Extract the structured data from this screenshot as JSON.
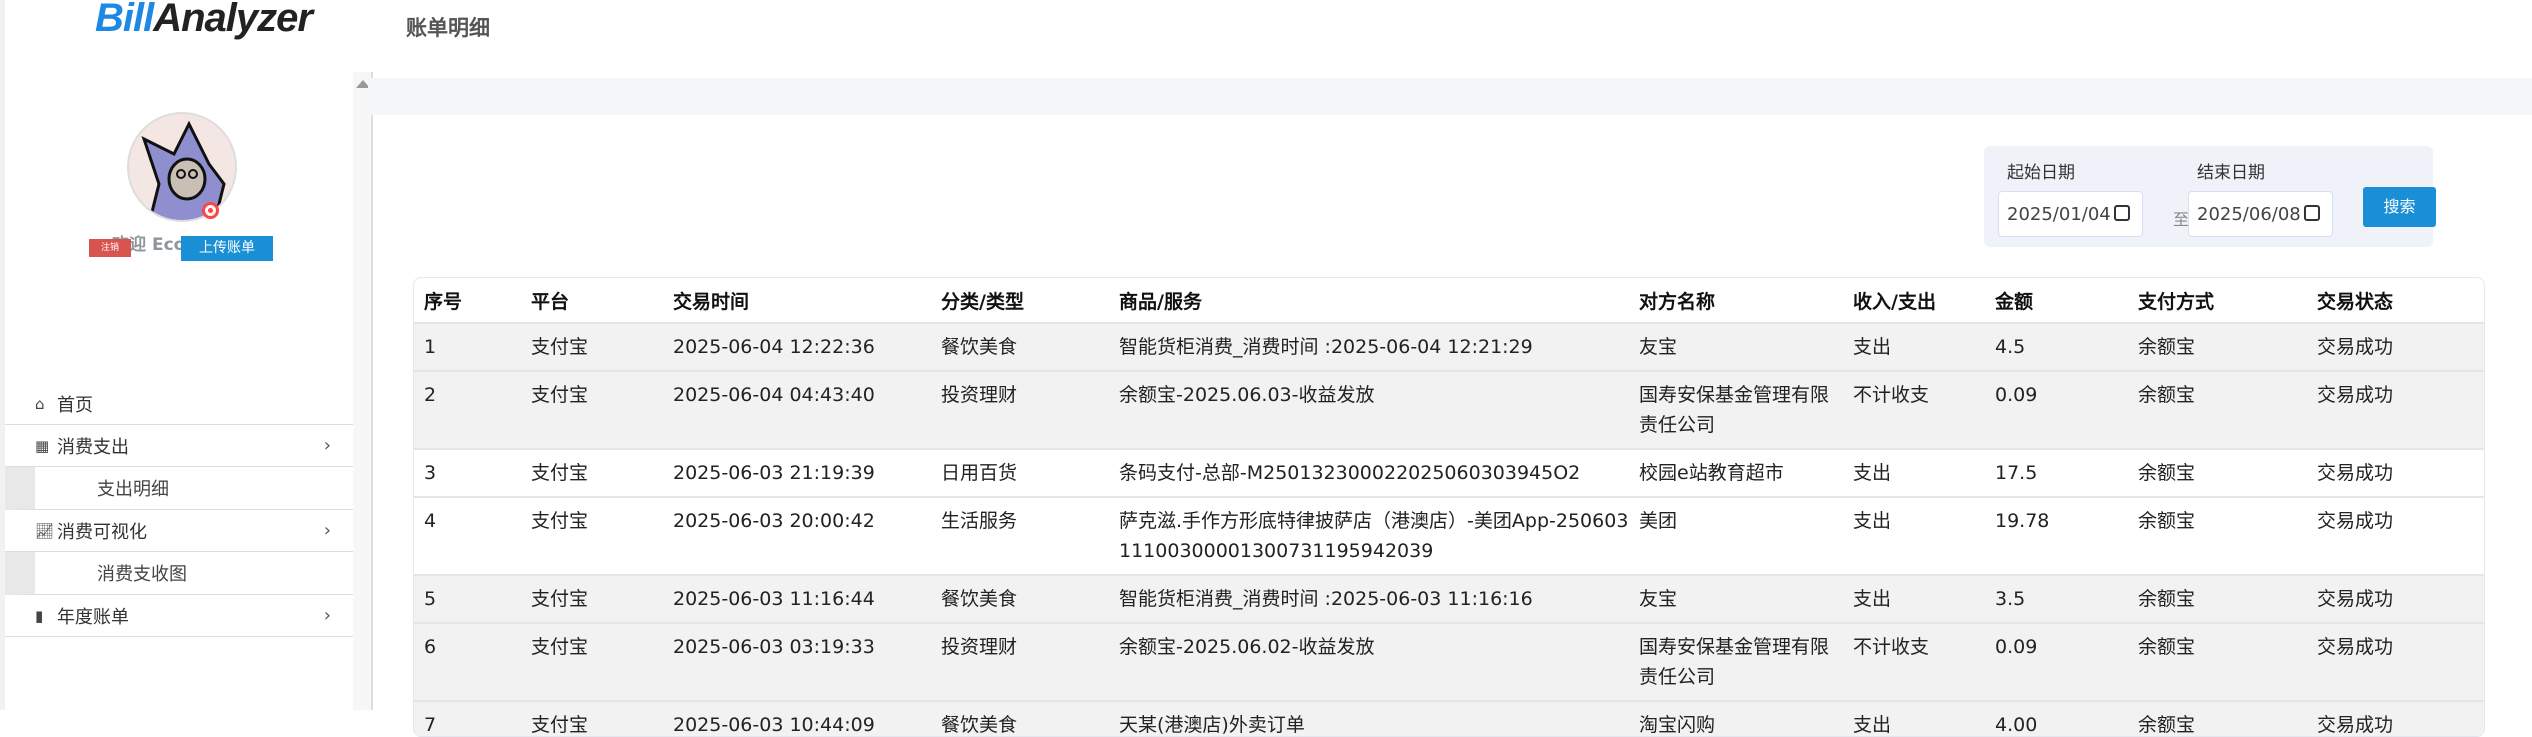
{
  "app": {
    "logo_part1": "Bill",
    "logo_part2": "Analyzer",
    "page_title": "账单明细"
  },
  "sidebar": {
    "welcome": "欢迎 Ecokayiza",
    "logout": "注销",
    "upload": "上传账单",
    "items": [
      {
        "label": "首页",
        "icon": "home-icon"
      },
      {
        "label": "消费支出",
        "icon": "table-icon"
      },
      {
        "label": "支出明细"
      },
      {
        "label": "消费可视化",
        "icon": "line-chart-icon"
      },
      {
        "label": "消费支收图"
      },
      {
        "label": "年度账单",
        "icon": "file-icon"
      }
    ]
  },
  "filter": {
    "start_label": "起始日期",
    "start_value": "2025/01/04",
    "to": "至",
    "end_label": "结束日期",
    "end_value": "2025/06/08",
    "search": "搜索"
  },
  "table": {
    "headers": [
      "序号",
      "平台",
      "交易时间",
      "分类/类型",
      "商品/服务",
      "对方名称",
      "收入/支出",
      "金额",
      "支付方式",
      "交易状态"
    ],
    "rows": [
      [
        "1",
        "支付宝",
        "2025-06-04 12:22:36",
        "餐饮美食",
        "智能货柜消费_消费时间 :2025-06-04 12:21:29",
        "友宝",
        "支出",
        "4.5",
        "余额宝",
        "交易成功"
      ],
      [
        "2",
        "支付宝",
        "2025-06-04 04:43:40",
        "投资理财",
        "余额宝-2025.06.03-收益发放",
        "国寿安保基金管理有限责任公司",
        "不计收支",
        "0.09",
        "余额宝",
        "交易成功"
      ],
      [
        "3",
        "支付宝",
        "2025-06-03 21:19:39",
        "日用百货",
        "条码支付-总部-M250132300022025060303945O2",
        "校园e站教育超市",
        "支出",
        "17.5",
        "余额宝",
        "交易成功"
      ],
      [
        "4",
        "支付宝",
        "2025-06-03 20:00:42",
        "生活服务",
        "萨克滋.手作方形底特律披萨店（港澳店）-美团App-25060311100300001300731195942039",
        "美团",
        "支出",
        "19.78",
        "余额宝",
        "交易成功"
      ],
      [
        "5",
        "支付宝",
        "2025-06-03 11:16:44",
        "餐饮美食",
        "智能货柜消费_消费时间 :2025-06-03 11:16:16",
        "友宝",
        "支出",
        "3.5",
        "余额宝",
        "交易成功"
      ],
      [
        "6",
        "支付宝",
        "2025-06-03 03:19:33",
        "投资理财",
        "余额宝-2025.06.02-收益发放",
        "国寿安保基金管理有限责任公司",
        "不计收支",
        "0.09",
        "余额宝",
        "交易成功"
      ],
      [
        "7",
        "支付宝",
        "2025-06-03 10:44:09",
        "餐饮美食",
        "天某(港澳店)外卖订单",
        "淘宝闪购",
        "支出",
        "4.00",
        "余额宝",
        "交易成功"
      ]
    ]
  }
}
